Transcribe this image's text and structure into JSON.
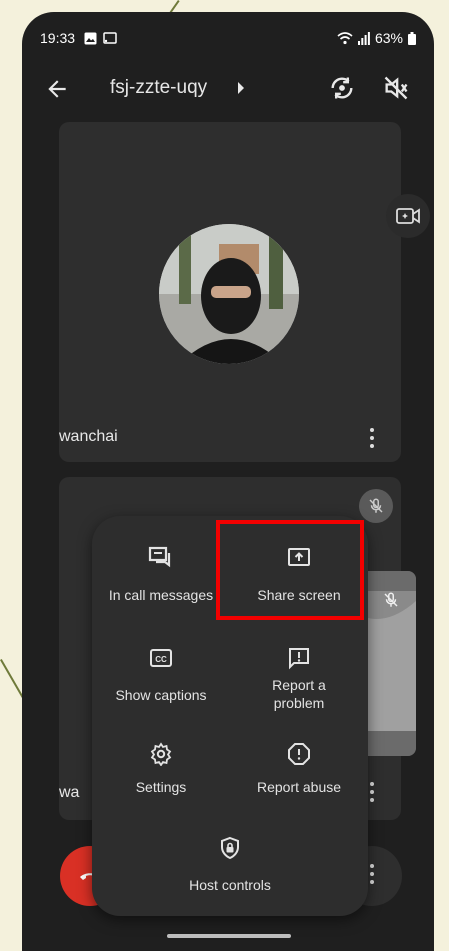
{
  "status_bar": {
    "time": "19:33",
    "battery": "63%"
  },
  "header": {
    "meeting_code": "fsj-zzte-uqy"
  },
  "tiles": [
    {
      "participant_name": "wanchai"
    },
    {
      "participant_name": "wa"
    }
  ],
  "menu": {
    "items": [
      {
        "label": "In call messages"
      },
      {
        "label": "Share screen"
      },
      {
        "label": "Show captions"
      },
      {
        "label": "Report a problem"
      },
      {
        "label": "Settings"
      },
      {
        "label": "Report abuse"
      },
      {
        "label": "Host controls"
      }
    ],
    "highlighted_item": "Share screen"
  },
  "colors": {
    "background": "#1f1f1f",
    "tile": "#2e2e2e",
    "sheet": "#2d2d2d",
    "end_call": "#d93025",
    "highlight": "#f20000",
    "text": "#e3e3e3"
  }
}
